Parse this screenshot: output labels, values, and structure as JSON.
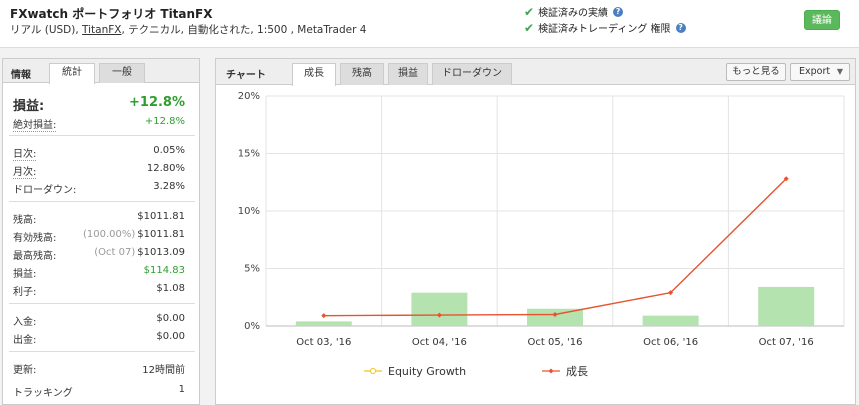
{
  "header": {
    "title": "FXwatch ポートフォリオ TitanFX",
    "subtitle_prefix": "リアル (USD),",
    "broker": "TitanFX",
    "subtitle_suffix": ", テクニカル, 自動化された, 1:500 , MetaTrader 4",
    "verified_track": "検証済みの実績",
    "verified_permission": "検証済みトレーディング 権限",
    "discuss_label": "議論"
  },
  "left": {
    "label": "情報",
    "tab_stats": "統計",
    "tab_general": "一般",
    "gain_label": "損益:",
    "gain_value": "+12.8%",
    "abs_gain_label": "絶対損益:",
    "abs_gain_value": "+12.8%",
    "daily_label": "日次:",
    "daily_value": "0.05%",
    "monthly_label": "月次:",
    "monthly_value": "12.80%",
    "drawdown_label": "ドローダウン:",
    "drawdown_value": "3.28%",
    "balance_label": "残高:",
    "balance_value": "$1011.81",
    "equity_label": "有効残高:",
    "equity_note": "(100.00%)",
    "equity_value": "$1011.81",
    "highest_label": "最高残高:",
    "highest_note": "(Oct 07)",
    "highest_value": "$1013.09",
    "profit_label": "損益:",
    "profit_value": "$114.83",
    "interest_label": "利子:",
    "interest_value": "$1.08",
    "deposit_label": "入金:",
    "deposit_value": "$0.00",
    "withdraw_label": "出金:",
    "withdraw_value": "$0.00",
    "updated_label": "更新:",
    "updated_value": "12時間前",
    "tracking_label": "トラッキング",
    "tracking_value": "1"
  },
  "right": {
    "label": "チャート",
    "tabs": [
      "成長",
      "残高",
      "損益",
      "ドローダウン"
    ],
    "more_label": "もっと見る",
    "export_label": "Export"
  },
  "colors": {
    "line": "#e8532f",
    "bar": "#b5e3b0",
    "legend_equity": "#f0c419",
    "accent_green": "#2f9e2f"
  },
  "chart_data": {
    "type": "bar+line",
    "categories": [
      "Oct 03, '16",
      "Oct 04, '16",
      "Oct 05, '16",
      "Oct 06, '16",
      "Oct 07, '16"
    ],
    "ylim": [
      0,
      20
    ],
    "yticks": [
      "0%",
      "5%",
      "10%",
      "15%",
      "20%"
    ],
    "series": [
      {
        "name": "成長",
        "kind": "line",
        "values": [
          0.9,
          0.95,
          1.0,
          2.9,
          12.8
        ]
      },
      {
        "name": "bars",
        "kind": "bar",
        "values": [
          0.4,
          2.9,
          1.5,
          0.9,
          3.4
        ]
      }
    ],
    "legend": [
      "Equity Growth",
      "成長"
    ],
    "legend_position": "bottom",
    "grid": true
  }
}
